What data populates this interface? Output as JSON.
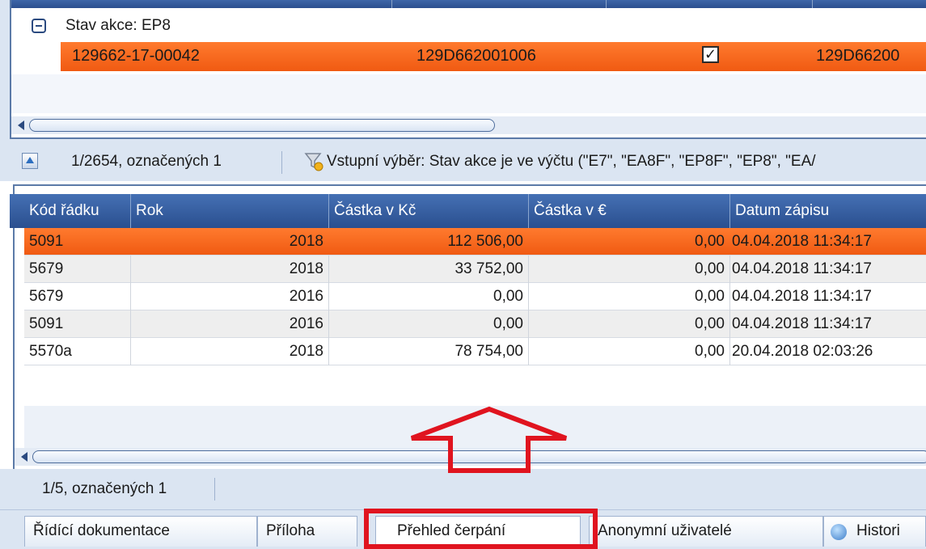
{
  "top_grid": {
    "group_label": "Stav akce: EP8",
    "selected_row": {
      "col1": "129662-17-00042",
      "col2": "129D662001006",
      "checkbox_mark": "✓",
      "col4": "129D66200"
    }
  },
  "status_top": {
    "record_count": "1/2654, označených 1",
    "filter_text": "Vstupní výběr: Stav akce je ve výčtu (\"E7\", \"EA8F\", \"EP8F\", \"EP8\", \"EA/"
  },
  "detail_grid": {
    "columns": [
      "Kód řádku",
      "Rok",
      "Částka v Kč",
      "Částka v €",
      "Datum zápisu"
    ],
    "rows": [
      {
        "kod": "5091",
        "rok": "2018",
        "czk": "112 506,00",
        "eur": "0,00",
        "datum": "04.04.2018 11:34:17"
      },
      {
        "kod": "5679",
        "rok": "2018",
        "czk": "33 752,00",
        "eur": "0,00",
        "datum": "04.04.2018 11:34:17"
      },
      {
        "kod": "5679",
        "rok": "2016",
        "czk": "0,00",
        "eur": "0,00",
        "datum": "04.04.2018 11:34:17"
      },
      {
        "kod": "5091",
        "rok": "2016",
        "czk": "0,00",
        "eur": "0,00",
        "datum": "04.04.2018 11:34:17"
      },
      {
        "kod": "5570a",
        "rok": "2018",
        "czk": "78 754,00",
        "eur": "0,00",
        "datum": "20.04.2018 02:03:26"
      }
    ],
    "selected_row_index": 0
  },
  "status_bottom": {
    "record_count": "1/5, označených 1"
  },
  "tabs": {
    "items": [
      "Řídící dokumentace",
      "Příloha",
      "Přehled čerpání",
      "Anonymní uživatelé",
      "Histori"
    ],
    "active_index": 2
  },
  "colors": {
    "selection": "#f05a12",
    "header": "#2a4f8f",
    "annotation": "#e0141f",
    "panel": "#dbe5f2"
  }
}
